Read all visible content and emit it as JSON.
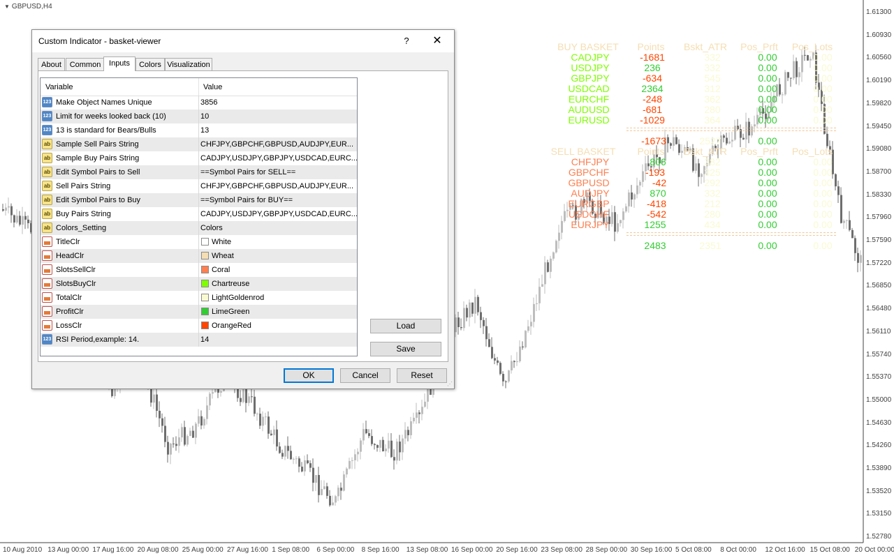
{
  "chart": {
    "title": "GBPUSD,H4",
    "price_axis": [
      "1.61300",
      "1.60930",
      "1.60560",
      "1.60190",
      "1.59820",
      "1.59450",
      "1.59080",
      "1.58700",
      "1.58330",
      "1.57960",
      "1.57590",
      "1.57220",
      "1.56850",
      "1.56480",
      "1.56110",
      "1.55740",
      "1.55370",
      "1.55000",
      "1.54630",
      "1.54260",
      "1.53890",
      "1.53520",
      "1.53150",
      "1.52780"
    ],
    "date_axis": [
      "10 Aug 2010",
      "13 Aug 00:00",
      "17 Aug 16:00",
      "20 Aug 08:00",
      "25 Aug 00:00",
      "27 Aug 16:00",
      "1 Sep 08:00",
      "6 Sep 00:00",
      "8 Sep 16:00",
      "13 Sep 08:00",
      "16 Sep 00:00",
      "20 Sep 16:00",
      "23 Sep 08:00",
      "28 Sep 00:00",
      "30 Sep 16:00",
      "5 Oct 08:00",
      "8 Oct 00:00",
      "12 Oct 16:00",
      "15 Oct 08:00",
      "20 Oct 00:00"
    ],
    "colors": {
      "bull": "#bdbdbd",
      "bear": "#6e6e6e",
      "axis": "#404040"
    }
  },
  "overlay": {
    "colors": {
      "title": "#FFFFFF",
      "head": "#F5DEB3",
      "sell": "#FF7F50",
      "buy": "#7FFF00",
      "total": "#FAFAD2",
      "profit": "#32CD32",
      "loss": "#FF4500"
    },
    "buy_header": {
      "title": "BUY BASKET",
      "points": "Points",
      "atr": "Bskt_ATR",
      "prft": "Pos_Prft",
      "lots": "Pos_Lots"
    },
    "buy_rows": [
      {
        "pair": "CADJPY",
        "points": "-1681",
        "atr": "332",
        "prft": "0.00",
        "lots": "0.00"
      },
      {
        "pair": "USDJPY",
        "points": "236",
        "atr": "332",
        "prft": "0.00",
        "lots": "0.00"
      },
      {
        "pair": "GBPJPY",
        "points": "-634",
        "atr": "545",
        "prft": "0.00",
        "lots": "0.00"
      },
      {
        "pair": "USDCAD",
        "points": "2364",
        "atr": "312",
        "prft": "0.00",
        "lots": "0.00"
      },
      {
        "pair": "EURCHF",
        "points": "-248",
        "atr": "362",
        "prft": "0.00",
        "lots": "0.00"
      },
      {
        "pair": "AUDUSD",
        "points": "-681",
        "atr": "280",
        "prft": "0.00",
        "lots": "0.00"
      },
      {
        "pair": "EURUSD",
        "points": "-1029",
        "atr": "364",
        "prft": "0.00",
        "lots": "0.00"
      }
    ],
    "buy_total": {
      "points": "-1673",
      "atr": "2527",
      "prft": "0.00"
    },
    "sell_header": {
      "title": "SELL BASKET",
      "points": "Points",
      "atr": "Bskt_ATR",
      "prft": "Pos_Prft",
      "lots": "Pos_Lots"
    },
    "sell_rows": [
      {
        "pair": "CHFJPY",
        "points": "806",
        "atr": "382",
        "prft": "0.00",
        "lots": "0.00"
      },
      {
        "pair": "GBPCHF",
        "points": "-193",
        "atr": "325",
        "prft": "0.00",
        "lots": "0.00"
      },
      {
        "pair": "GBPUSD",
        "points": "-42",
        "atr": "292",
        "prft": "0.00",
        "lots": "0.00"
      },
      {
        "pair": "AUDJPY",
        "points": "870",
        "atr": "332",
        "prft": "0.00",
        "lots": "0.00"
      },
      {
        "pair": "EURGBP",
        "points": "-418",
        "atr": "212",
        "prft": "0.00",
        "lots": "0.00"
      },
      {
        "pair": "USDCHF",
        "points": "-542",
        "atr": "280",
        "prft": "0.00",
        "lots": "0.00"
      },
      {
        "pair": "EURJPY",
        "points": "1255",
        "atr": "434",
        "prft": "0.00",
        "lots": "0.00"
      }
    ],
    "sell_total": {
      "points": "2483",
      "atr": "2351",
      "prft": "0.00",
      "lots": "0.00"
    }
  },
  "dialog": {
    "title": "Custom Indicator - basket-viewer",
    "help": "?",
    "close": "✕",
    "tabs": [
      "About",
      "Common",
      "Inputs",
      "Colors",
      "Visualization"
    ],
    "active_tab": "Inputs",
    "columns": {
      "variable": "Variable",
      "value": "Value"
    },
    "rows": [
      {
        "type": "123",
        "name": "Make Object Names Unique",
        "value": "3856"
      },
      {
        "type": "123",
        "name": "Limit for weeks looked back (10)",
        "value": "10"
      },
      {
        "type": "123",
        "name": "13 is standard for Bears/Bulls",
        "value": "13"
      },
      {
        "type": "ab",
        "name": "Sample Sell Pairs String",
        "value": "CHFJPY,GBPCHF,GBPUSD,AUDJPY,EUR..."
      },
      {
        "type": "ab",
        "name": "Sample Buy Pairs String",
        "value": "CADJPY,USDJPY,GBPJPY,USDCAD,EURC..."
      },
      {
        "type": "ab",
        "name": "Edit Symbol Pairs to Sell",
        "value": "==Symbol Pairs for SELL=="
      },
      {
        "type": "ab",
        "name": "Sell Pairs String",
        "value": "CHFJPY,GBPCHF,GBPUSD,AUDJPY,EUR..."
      },
      {
        "type": "ab",
        "name": "Edit Symbol Pairs to Buy",
        "value": "==Symbol Pairs for BUY=="
      },
      {
        "type": "ab",
        "name": "Buy Pairs String",
        "value": "CADJPY,USDJPY,GBPJPY,USDCAD,EURC..."
      },
      {
        "type": "ab",
        "name": "Colors_Setting",
        "value": "Colors"
      },
      {
        "type": "clr",
        "name": "TitleClr",
        "value": "White",
        "swatch": "#FFFFFF"
      },
      {
        "type": "clr",
        "name": "HeadClr",
        "value": "Wheat",
        "swatch": "#F5DEB3"
      },
      {
        "type": "clr",
        "name": "SlotsSellClr",
        "value": "Coral",
        "swatch": "#FF7F50"
      },
      {
        "type": "clr",
        "name": "SlotsBuyClr",
        "value": "Chartreuse",
        "swatch": "#7FFF00"
      },
      {
        "type": "clr",
        "name": "TotalClr",
        "value": "LightGoldenrod",
        "swatch": "#FAFAD2"
      },
      {
        "type": "clr",
        "name": "ProfitClr",
        "value": "LimeGreen",
        "swatch": "#32CD32"
      },
      {
        "type": "clr",
        "name": "LossClr",
        "value": "OrangeRed",
        "swatch": "#FF4500"
      },
      {
        "type": "123",
        "name": "RSI Period,example: 14.",
        "value": "14"
      }
    ],
    "buttons": {
      "load": "Load",
      "save": "Save",
      "ok": "OK",
      "cancel": "Cancel",
      "reset": "Reset"
    }
  }
}
